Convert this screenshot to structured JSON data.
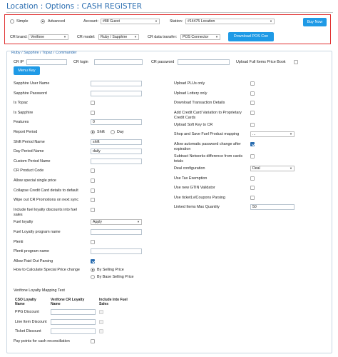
{
  "page": {
    "title": "Location : Options : CASH REGISTER"
  },
  "top": {
    "mode_simple": "Simple",
    "mode_advanced": "Advanced",
    "account_label": "Account:",
    "account_value": "#88 Guest",
    "station_label": "Station:",
    "station_value": "#14475 Location",
    "buy_now": "Buy Now",
    "cr_brand_label": "CR brand:",
    "cr_brand_value": "Verifone",
    "cr_model_label": "CR model:",
    "cr_model_value": "Ruby / Sapphire",
    "cr_transfer_label": "CR data transfer:",
    "cr_transfer_value": "POS Connector",
    "download_pos": "Download POS Con"
  },
  "panel": {
    "title": "Ruby / Sapphire / Topaz / Commander",
    "cr_ip_label": "CR IP",
    "cr_login_label": "CR login",
    "cr_password_label": "CR password",
    "upload_full_label": "Upload Full Items Price Book",
    "menu_key": "Menu Key"
  },
  "left_fields": [
    {
      "label": "Sapphire User Name",
      "type": "input",
      "value": ""
    },
    {
      "label": "Sapphire Password",
      "type": "input",
      "value": ""
    },
    {
      "label": "Is Topaz",
      "type": "check",
      "checked": false
    },
    {
      "label": "Is Sapphire",
      "type": "check",
      "checked": false
    },
    {
      "label": "Features",
      "type": "input",
      "value": "0"
    },
    {
      "label": "Report Period",
      "type": "radio2",
      "opt1": "Shift",
      "opt2": "Day",
      "selected": "Shift"
    },
    {
      "label": "Shift Period Name",
      "type": "input",
      "value": "shift"
    },
    {
      "label": "Day Period Name",
      "type": "input",
      "value": "daily"
    },
    {
      "label": "Custom Period Name",
      "type": "input",
      "value": ""
    },
    {
      "label": "CR Product Code",
      "type": "check",
      "checked": false
    },
    {
      "label": "Allow special single price",
      "type": "check",
      "checked": false
    },
    {
      "label": "Collapse Credit Card details to default",
      "type": "check",
      "checked": false
    },
    {
      "label": "Wipe out CR Promotions on next sync",
      "type": "check",
      "checked": false
    },
    {
      "label": "Include fuel loyalty discounts into fuel sales",
      "type": "check",
      "checked": false
    },
    {
      "label": "Fuel loyalty",
      "type": "select",
      "value": "Apply"
    },
    {
      "label": "Fuel Loyalty program name",
      "type": "input",
      "value": ""
    },
    {
      "label": "Plenti",
      "type": "check",
      "checked": false
    },
    {
      "label": "Plenti program name",
      "type": "input",
      "value": ""
    },
    {
      "label": "Allow Paid Out Parsing",
      "type": "check",
      "checked": true
    },
    {
      "label": "How to Calculate Special Price change",
      "type": "radio2v",
      "opt1": "By Selling Price",
      "opt2": "By Base Selling Price",
      "selected": "By Selling Price"
    }
  ],
  "right_fields": [
    {
      "label": "Upload PLUs only",
      "type": "check",
      "checked": false
    },
    {
      "label": "Upload Lottery only",
      "type": "check",
      "checked": false
    },
    {
      "label": "Download Transaction Details",
      "type": "check",
      "checked": false
    },
    {
      "label": "Add Credit Card Variation to Proprietary Credit Cards",
      "type": "check",
      "checked": false
    },
    {
      "label": "Upload Soft Key to CR",
      "type": "check",
      "checked": false
    },
    {
      "label": "Shop and Save Fuel Product mapping",
      "type": "select",
      "value": "..."
    },
    {
      "label": "Allow automatic password change after expiration",
      "type": "check",
      "checked": true
    },
    {
      "label": "Subtract Networks difference from cards totals",
      "type": "check",
      "checked": false
    },
    {
      "label": "Deal configuration",
      "type": "select",
      "value": "Deal"
    },
    {
      "label": "Use Tax Exemption",
      "type": "check",
      "checked": false
    },
    {
      "label": "Use new GTIN Validator",
      "type": "check",
      "checked": false
    },
    {
      "label": "Use ticketLvlCoupons Parsing",
      "type": "check",
      "checked": false
    },
    {
      "label": "Linked Items Max Quantity",
      "type": "input",
      "value": "50"
    }
  ],
  "loyalty": {
    "title": "Verifone Loyalty Mapping Test",
    "col1": "CSO Loyalty Name",
    "col2": "Verifone CR Loyalty Name",
    "col3": "Include Into Fuel Sales",
    "rows": [
      {
        "name": "PPG Discount"
      },
      {
        "name": "Line Item Discount"
      },
      {
        "name": "Ticket Discount"
      }
    ]
  },
  "bottom": {
    "pay_points_label": "Pay points for cash reconciliation"
  }
}
